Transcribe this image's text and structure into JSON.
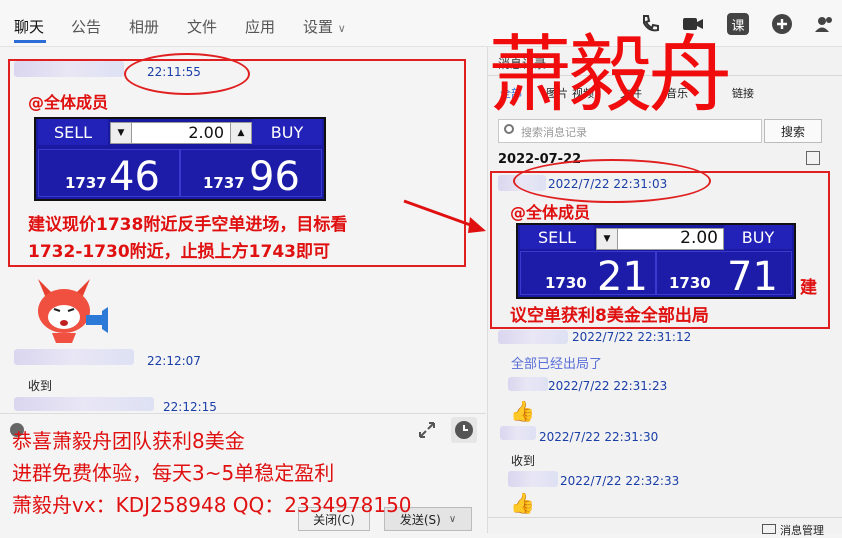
{
  "tabs": [
    {
      "label": "聊天"
    },
    {
      "label": "公告"
    },
    {
      "label": "相册"
    },
    {
      "label": "文件"
    },
    {
      "label": "应用"
    },
    {
      "label": "设置"
    }
  ],
  "topicons": {
    "course": "课"
  },
  "left_chat": {
    "msg1_time": "22:11:55",
    "msg1_mention": "@全体成员",
    "msg1_trade": {
      "sell": "SELL",
      "buy": "BUY",
      "qty": "2.00",
      "sell_small": "1737",
      "sell_big": "46",
      "buy_small": "1737",
      "buy_big": "96"
    },
    "msg1_text_line1": "建议现价1738附近反手空单进场，目标看",
    "msg1_text_line2": "1732-1730附近，止损上方1743即可",
    "msg2_time": "22:12:07",
    "msg2_text": "收到",
    "msg3_time": "22:12:15"
  },
  "composer": {
    "close_label": "关闭(C)",
    "send_label": "发送(S)"
  },
  "ad_lines": [
    "恭喜萧毅舟团队获利8美金",
    "进群免费体验，每天3~5单稳定盈利",
    "萧毅舟vx：KDJ258948  QQ：2334978150"
  ],
  "big_name": "萧毅舟",
  "history": {
    "title": "消息记录",
    "filters": [
      "全部",
      "图片",
      "视频",
      "文件",
      "音乐",
      "链接"
    ],
    "search_placeholder": "搜索消息记录",
    "search_button": "搜索",
    "date": "2022-07-22",
    "msg1_time": "2022/7/22 22:31:03",
    "msg1_mention": "@全体成员",
    "msg1_trade": {
      "sell": "SELL",
      "buy": "BUY",
      "qty": "2.00",
      "sell_small": "1730",
      "sell_big": "21",
      "buy_small": "1730",
      "buy_big": "71"
    },
    "msg1_text_a": "建",
    "msg1_text_b": "议空单获利8美金全部出局",
    "msg2_time": "2022/7/22 22:31:12",
    "msg2_text": "全部已经出局了",
    "msg3_time": "2022/7/22 22:31:23",
    "msg4_time": "2022/7/22 22:31:30",
    "msg4_text": "收到",
    "msg5_time": "2022/7/22 22:32:33",
    "manage": "消息管理"
  }
}
